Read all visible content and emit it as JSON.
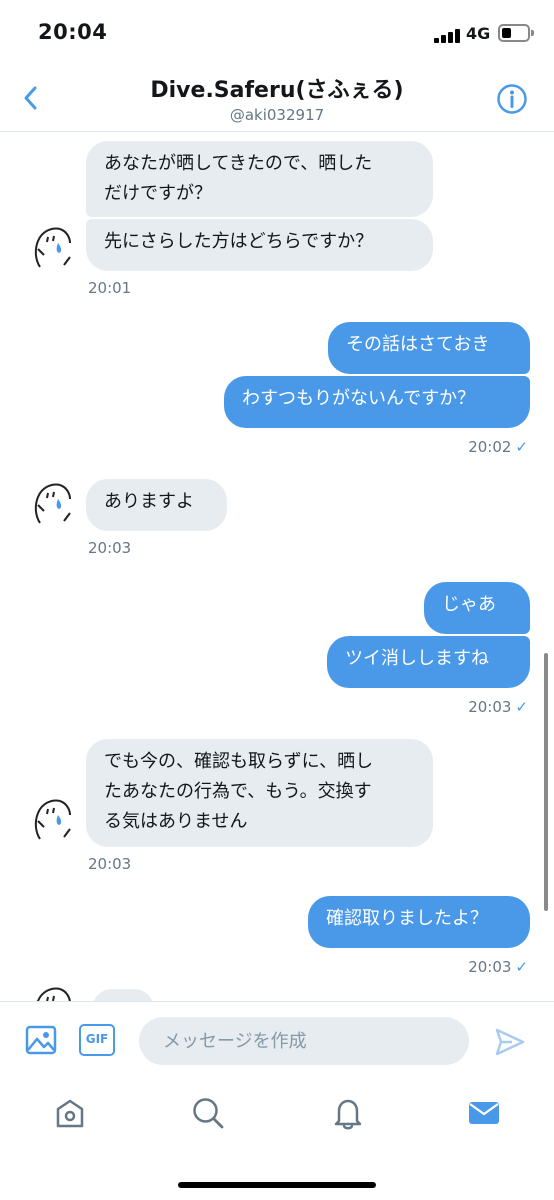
{
  "status_bar": {
    "time": "20:04",
    "network": "4G"
  },
  "header": {
    "title": "Dive.Saferu(さふぇる)",
    "handle": "@aki032917"
  },
  "messages": [
    {
      "dir": "in",
      "lines": [
        "あなたが晒してきたので、晒した",
        "だけですが？"
      ]
    },
    {
      "dir": "in",
      "lines": [
        "先にさらした方はどちらですか？"
      ]
    },
    {
      "dir": "in_time",
      "time": "20:01"
    },
    {
      "dir": "out",
      "lines": [
        "その話はさておき"
      ]
    },
    {
      "dir": "out",
      "lines": [
        "わすつもりがないんですか？"
      ]
    },
    {
      "dir": "out_time",
      "time": "20:02"
    },
    {
      "dir": "in",
      "lines": [
        "ありますよ"
      ]
    },
    {
      "dir": "in_time",
      "time": "20:03"
    },
    {
      "dir": "out",
      "lines": [
        "じゃあ"
      ]
    },
    {
      "dir": "out",
      "lines": [
        "ツイ消ししますね"
      ]
    },
    {
      "dir": "out_time",
      "time": "20:03"
    },
    {
      "dir": "in",
      "lines": [
        "でも今の、確認も取らずに、晒し",
        "たあなたの行為で、もう。交換す",
        "る気はありません"
      ]
    },
    {
      "dir": "in_time",
      "time": "20:03"
    },
    {
      "dir": "out",
      "lines": [
        "確認取りましたよ？"
      ]
    },
    {
      "dir": "out_time",
      "time": "20:03"
    }
  ],
  "composer": {
    "placeholder": "メッセージを作成",
    "gif_label": "GIF"
  },
  "read_check": "✓",
  "colors": {
    "accent": "#4a99e9",
    "incoming_bubble": "#e6ecf0",
    "secondary_text": "#657786"
  },
  "icons": {
    "header": [
      "chevron-left-icon",
      "info-icon"
    ],
    "composer": [
      "photo-icon",
      "gif-icon",
      "send-icon"
    ],
    "tabs": [
      "home-icon",
      "search-icon",
      "notifications-icon",
      "messages-icon"
    ]
  }
}
